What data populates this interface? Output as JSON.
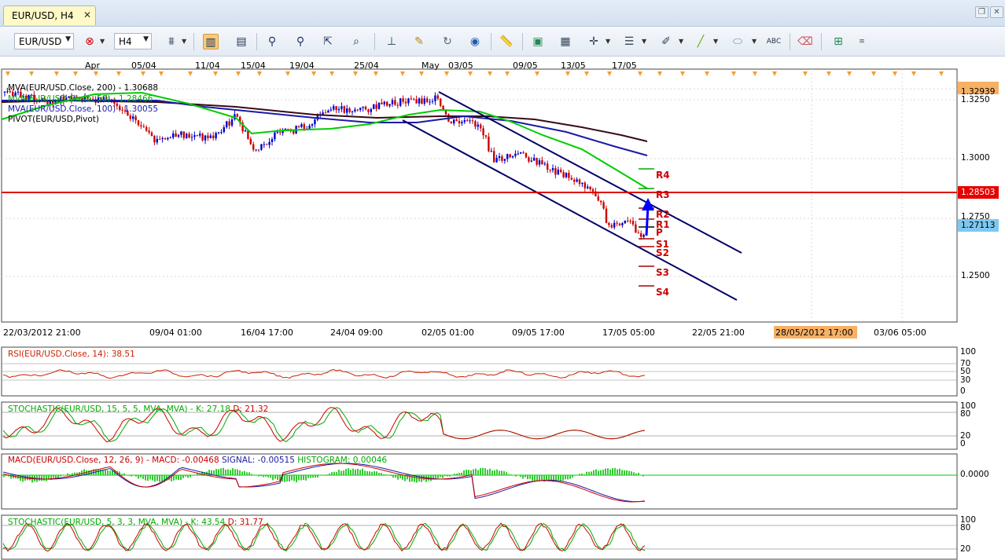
{
  "window": {
    "tab_title": "EUR/USD, H4",
    "close_glyph": "✕",
    "restore_glyph": "❐",
    "close_window_glyph": "✕"
  },
  "toolbar": {
    "symbol": "EUR/USD",
    "timeframe": "H4",
    "icons": [
      "instrument-remove-icon",
      "bar-type-icon",
      "candle-chart-icon",
      "line-chart-icon",
      "zoom-in-icon",
      "zoom-out-icon",
      "cursor-icon",
      "zoom-area-icon",
      "data-box-icon",
      "highlight-icon",
      "refresh-icon",
      "globe-icon",
      "ruler-icon",
      "image-icon",
      "template-icon",
      "crosshair-icon",
      "indicators-icon",
      "pen-icon",
      "line-tool-icon",
      "ellipse-icon",
      "text-tool-icon",
      "eraser-icon",
      "object-tree-icon"
    ]
  },
  "colors": {
    "background": "#ffffff",
    "candle_up": "#0000cc",
    "candle_down": "#cc0000",
    "mva200": "#3a0a14",
    "mva50": "#00cc00",
    "mva100": "#1a1aa8",
    "channel": "#000066",
    "resistance_line": "#dd0000",
    "current_price_box": "#7ec8f0",
    "pivot_text": "#cc0000"
  },
  "main_chart": {
    "legend": [
      {
        "text": "MVA(EUR/USD.Close, 200) - 1.30688",
        "color": "#3a0a14"
      },
      {
        "text": "MVA(EUR/USD.Close, 50) - 1.28466",
        "color": "#00aa00"
      },
      {
        "text": "MVA(EUR/USD.Close, 100) - 1.30055",
        "color": "#1a1aa8"
      },
      {
        "text": "PIVOT(EUR/USD,Pivot)",
        "color": "#000000"
      }
    ],
    "top_dates": [
      "Apr",
      "05/04",
      "11/04",
      "15/04",
      "19/04",
      "25/04",
      "May",
      "03/05",
      "09/05",
      "13/05",
      "17/05"
    ],
    "bottom_dates": [
      "22/03/2012 21:00",
      "09/04 01:00",
      "16/04 17:00",
      "24/04 09:00",
      "02/05 01:00",
      "09/05 17:00",
      "17/05 05:00",
      "22/05 21:00",
      "03/06 05:00"
    ],
    "future_date": "28/05/2012 17:00",
    "price_axis": [
      "1.3250",
      "1.3000",
      "1.2750",
      "1.2500"
    ],
    "price_high": "1.32939",
    "price_resistance": "1.28503",
    "price_current": "1.27113",
    "pivot_levels": [
      "R4",
      "R3",
      "R2",
      "R1",
      "P",
      "S1",
      "S2",
      "S3",
      "S4"
    ]
  },
  "indicators": {
    "rsi": {
      "label": "RSI(EUR/USD.Close, 14): 38.51",
      "axis": [
        "100",
        "70",
        "50",
        "30",
        "0"
      ]
    },
    "stoch1": {
      "label_prefix": "STOCHASTIC(EUR/USD, 15, 5, 5, MVA, MVA) -",
      "k": "K: 27.18",
      "d": "D: 21.32",
      "axis": [
        "100",
        "80",
        "20",
        "0"
      ]
    },
    "macd": {
      "label_prefix": "MACD(EUR/USD.Close, 12, 26, 9) -",
      "macd": "MACD: -0.00468",
      "signal": "SIGNAL: -0.00515",
      "histogram": "HISTOGRAM: 0.00046",
      "axis": [
        "0.0000"
      ]
    },
    "stoch2": {
      "label_prefix": "STOCHASTIC(EUR/USD, 5, 3, 3, MVA, MVA) -",
      "k": "K: 43.54",
      "d": "D: 31.77",
      "axis": [
        "100",
        "80",
        "20"
      ]
    }
  }
}
